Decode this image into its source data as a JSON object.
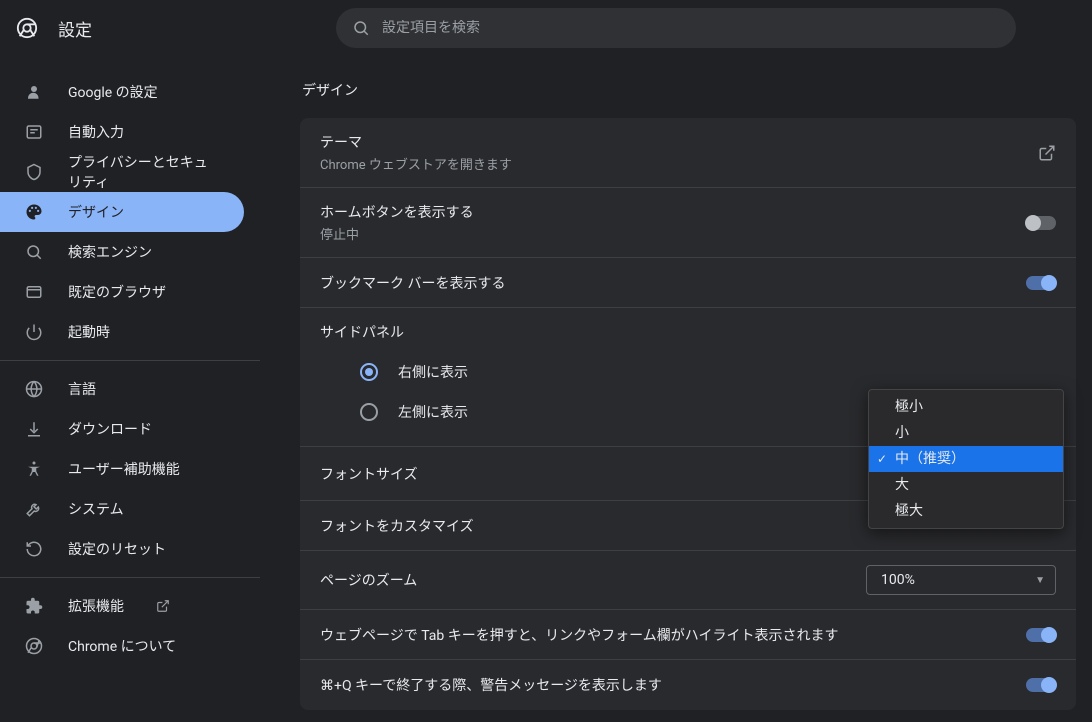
{
  "header": {
    "title": "設定",
    "search_placeholder": "設定項目を検索"
  },
  "sidebar": {
    "groups": [
      [
        {
          "icon": "person",
          "label": "Google の設定"
        },
        {
          "icon": "autofill",
          "label": "自動入力"
        },
        {
          "icon": "shield",
          "label": "プライバシーとセキュリティ"
        },
        {
          "icon": "palette",
          "label": "デザイン",
          "active": true
        },
        {
          "icon": "search",
          "label": "検索エンジン"
        },
        {
          "icon": "browser",
          "label": "既定のブラウザ"
        },
        {
          "icon": "power",
          "label": "起動時"
        }
      ],
      [
        {
          "icon": "globe",
          "label": "言語"
        },
        {
          "icon": "download",
          "label": "ダウンロード"
        },
        {
          "icon": "accessibility",
          "label": "ユーザー補助機能"
        },
        {
          "icon": "wrench",
          "label": "システム"
        },
        {
          "icon": "reset",
          "label": "設定のリセット"
        }
      ],
      [
        {
          "icon": "extension",
          "label": "拡張機能",
          "external": true
        },
        {
          "icon": "chrome",
          "label": "Chrome について"
        }
      ]
    ]
  },
  "main": {
    "title": "デザイン",
    "theme": {
      "label": "テーマ",
      "sub": "Chrome ウェブストアを開きます"
    },
    "home_button": {
      "label": "ホームボタンを表示する",
      "sub": "停止中",
      "on": false
    },
    "bookmark_bar": {
      "label": "ブックマーク バーを表示する",
      "on": true
    },
    "side_panel": {
      "label": "サイドパネル",
      "right": "右側に表示",
      "left": "左側に表示",
      "selected": "right"
    },
    "font_size": {
      "label": "フォントサイズ",
      "options": [
        "極小",
        "小",
        "中（推奨）",
        "大",
        "極大"
      ],
      "selected_index": 2
    },
    "customize_font": {
      "label": "フォントをカスタマイズ"
    },
    "page_zoom": {
      "label": "ページのズーム",
      "value": "100%"
    },
    "tab_highlight": {
      "label": "ウェブページで Tab キーを押すと、リンクやフォーム欄がハイライト表示されます",
      "on": true
    },
    "quit_warning": {
      "label": "⌘+Q キーで終了する際、警告メッセージを表示します",
      "on": true
    }
  }
}
